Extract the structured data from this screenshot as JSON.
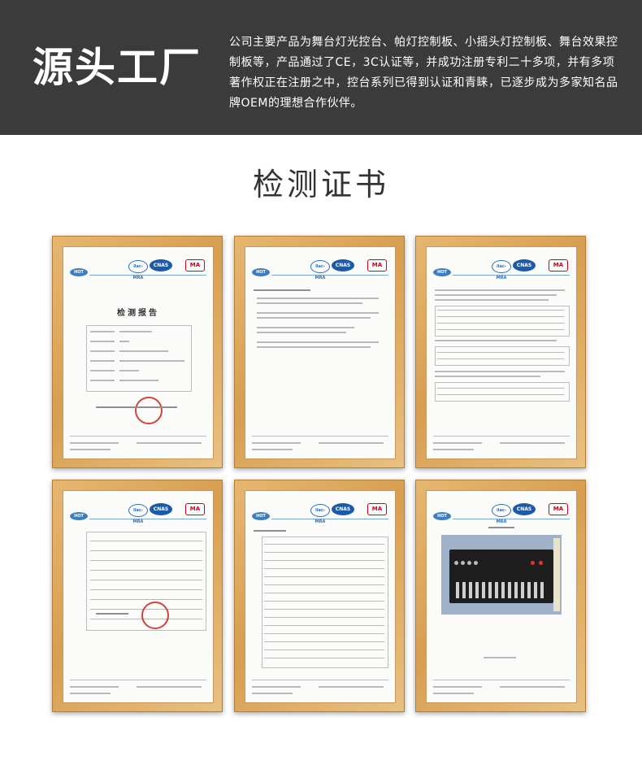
{
  "banner": {
    "title": "源头工厂",
    "description": "公司主要产品为舞台灯光控台、帕灯控制板、小摇头灯控制板、舞台效果控制板等，产品通过了CE，3C认证等，并成功注册专利二十多项，并有多项著作权正在注册之中，控台系列已得到认证和青睐，已逐步成为多家知名品牌OEM的理想合作伙伴。",
    "background_color": "#3b3b3b"
  },
  "section": {
    "title": "检测证书"
  },
  "certificates": {
    "report_heading": "检测报告",
    "logos": {
      "hot": "HOT",
      "ilac": "ilac-MRA",
      "cnas": "CNAS",
      "ma": "MA"
    },
    "frame_color": "#dba55c"
  }
}
